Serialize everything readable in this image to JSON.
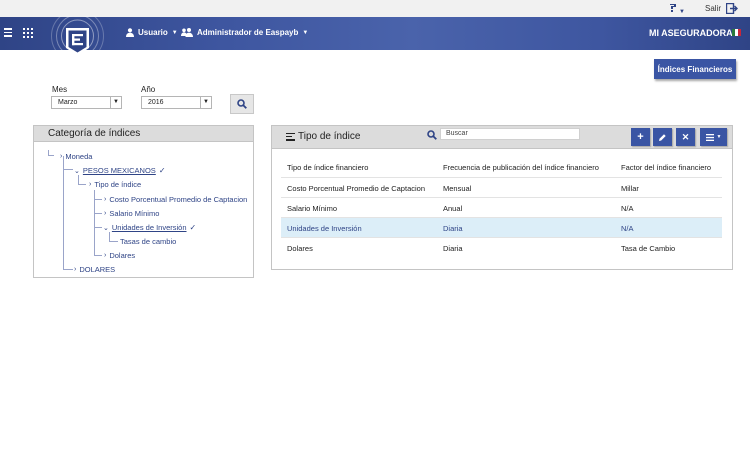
{
  "topbar": {
    "help_icon": "help-icon",
    "logout_label": "Salir",
    "logout_icon": "exit-icon"
  },
  "header": {
    "menu_icon": "hamburger-icon",
    "apps_icon": "grid-icon",
    "user_label": "Usuario",
    "admin_label": "Administrador de Easpayb",
    "company_label": "MI ASEGURADORA",
    "flag_colors": [
      "#2a7a3b",
      "#ffffff",
      "#c8263a"
    ],
    "brand_color": "#2f4486"
  },
  "indices_button": "Índices Financieros",
  "filters": {
    "mes_label": "Mes",
    "mes_value": "Marzo",
    "anio_label": "Año",
    "anio_value": "2016",
    "search_icon": "search-icon"
  },
  "left_panel": {
    "title": "Categoría de índices",
    "tree": [
      {
        "label": "Moneda"
      },
      {
        "label": "PESOS MEXICANOS"
      },
      {
        "label": "Tipo de índice"
      },
      {
        "label": "Costo Porcentual Promedio de Captacion"
      },
      {
        "label": "Salario Mínimo"
      },
      {
        "label": "Unidades de Inversión"
      },
      {
        "label": "Tasas de cambio"
      },
      {
        "label": "Dolares"
      },
      {
        "label": "DOLARES"
      }
    ]
  },
  "right_panel": {
    "title": "Tipo de índice",
    "search_placeholder": "Buscar",
    "toolbar": {
      "add": "+",
      "edit_icon": "pencil-icon",
      "delete": "✕",
      "menu_icon": "list-icon"
    },
    "columns": [
      "Tipo de índice financiero",
      "Frecuencia de publicación del índice financiero",
      "Factor del índice financiero"
    ],
    "rows": [
      [
        "Costo Porcentual Promedio de Captacion",
        "Mensual",
        "Millar"
      ],
      [
        "Salario Mínimo",
        "Anual",
        "N/A"
      ],
      [
        "Unidades de Inversión",
        "Diaria",
        "N/A"
      ],
      [
        "Dolares",
        "Diaria",
        "Tasa de Cambio"
      ]
    ],
    "selected_row": 2
  }
}
